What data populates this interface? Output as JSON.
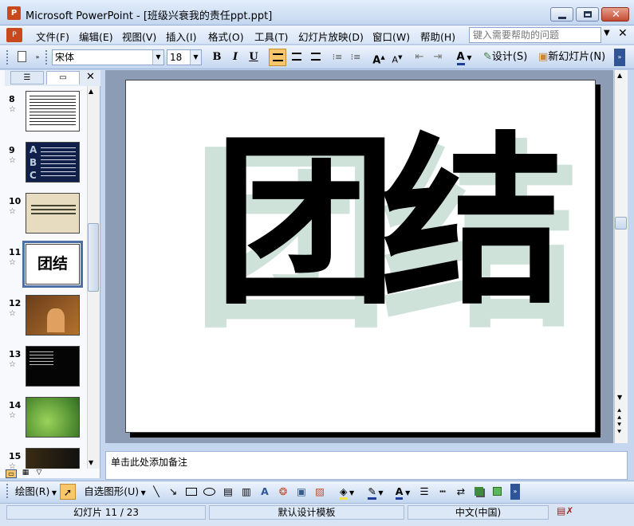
{
  "window": {
    "title": "Microsoft PowerPoint - [班级兴衰我的责任ppt.ppt]",
    "app_icon": "powerpoint-icon"
  },
  "menu": {
    "items": [
      "文件(F)",
      "编辑(E)",
      "视图(V)",
      "插入(I)",
      "格式(O)",
      "工具(T)",
      "幻灯片放映(D)",
      "窗口(W)",
      "帮助(H)"
    ],
    "help_placeholder": "键入需要帮助的问题"
  },
  "toolbar": {
    "font_name": "宋体",
    "font_size": "18",
    "bold": "B",
    "italic": "I",
    "underline": "U",
    "font_color_glyph": "A",
    "design_label": "设计(S)",
    "new_slide_label": "新幻灯片(N)"
  },
  "left_panel": {
    "tabs": [
      "outline",
      "slides"
    ],
    "active_tab": "slides",
    "thumbnails": [
      {
        "num": "8",
        "style": "black-text-white"
      },
      {
        "num": "9",
        "style": "abc-blue"
      },
      {
        "num": "10",
        "style": "tan-text"
      },
      {
        "num": "11",
        "style": "selected",
        "text": "团结"
      },
      {
        "num": "12",
        "style": "brown-photo"
      },
      {
        "num": "13",
        "style": "black-tree"
      },
      {
        "num": "14",
        "style": "green-leaves"
      },
      {
        "num": "15",
        "style": "dark-photo"
      }
    ],
    "selected": "11"
  },
  "slide": {
    "main_text": "团结",
    "shadow_text": "团结",
    "shadow_color": "#cfe2da",
    "text_color": "#000000"
  },
  "notes": {
    "placeholder": "单击此处添加备注"
  },
  "drawbar": {
    "draw_label": "绘图(R)",
    "autoshapes_label": "自选图形(U)"
  },
  "status": {
    "slide_info": "幻灯片 11 / 23",
    "template": "默认设计模板",
    "language": "中文(中国)"
  },
  "colors": {
    "accent": "#4c6fa6",
    "toolbar_bg": "#c4d7f0"
  }
}
